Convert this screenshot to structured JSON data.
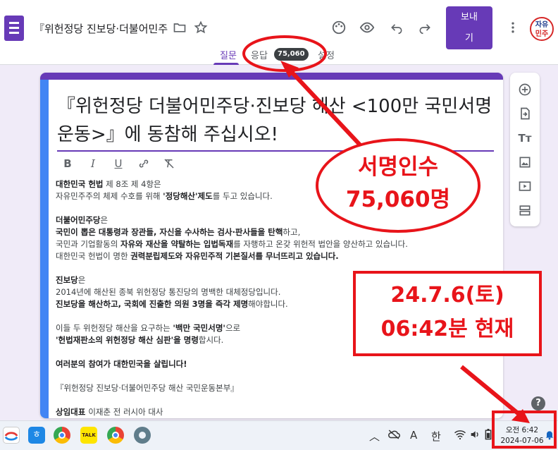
{
  "header": {
    "doc_title": "『위헌정당 진보당·더불어민주",
    "send_label_1": "보내",
    "send_label_2": "기",
    "avatar_text_1": "자유",
    "avatar_text_2": "민주",
    "tabs": [
      {
        "label": "질문"
      },
      {
        "label": "응답"
      },
      {
        "label": "설정"
      }
    ],
    "response_count": "75,060"
  },
  "form": {
    "title": "『위헌정당 더불어민주당·진보당 해산 <100만 국민서명운동>』에 동참해 주십시오!",
    "format_tools": [
      "B",
      "I",
      "U",
      "link",
      "clear"
    ],
    "description": [
      {
        "parts": [
          {
            "t": "대한민국 헌법",
            "b": true
          },
          {
            "t": " 제 8조 제 4항은",
            "b": false
          }
        ]
      },
      {
        "parts": [
          {
            "t": "자유민주주의 체제 수호를 위해 ",
            "b": false
          },
          {
            "t": "'정당해산'제도",
            "b": true
          },
          {
            "t": "를 두고 있습니다.",
            "b": false
          }
        ]
      },
      {
        "gap": true
      },
      {
        "parts": [
          {
            "t": "더불어민주당",
            "b": true
          },
          {
            "t": "은",
            "b": false
          }
        ]
      },
      {
        "parts": [
          {
            "t": "국민이 뽑은 대통령과 장관들, 자신을 수사하는 검사·판사들을 탄핵",
            "b": true
          },
          {
            "t": "하고,",
            "b": false
          }
        ]
      },
      {
        "parts": [
          {
            "t": "국민과 기업활동의 ",
            "b": false
          },
          {
            "t": "자유와 재산을 약탈하는 입법독재",
            "b": true
          },
          {
            "t": "를 자행하고 온갖 위헌적 법안을 양산하고 있습니다.",
            "b": false
          }
        ]
      },
      {
        "parts": [
          {
            "t": "대한민국 헌법이 명한 ",
            "b": false
          },
          {
            "t": "권력분립제도와 자유민주적 기본질서를 무너뜨리고 있습니다.",
            "b": true
          }
        ]
      },
      {
        "gap": true
      },
      {
        "parts": [
          {
            "t": "진보당",
            "b": true
          },
          {
            "t": "은",
            "b": false
          }
        ]
      },
      {
        "parts": [
          {
            "t": "2014년에 해산된 종북 위헌정당 통진당의 명백한 대체정당입니다.",
            "b": false
          }
        ]
      },
      {
        "parts": [
          {
            "t": "진보당을 해산하고, 국회에 진출한 의원 3명을 즉각 제명",
            "b": true
          },
          {
            "t": "해야합니다.",
            "b": false
          }
        ]
      },
      {
        "gap": true
      },
      {
        "parts": [
          {
            "t": "이들 두 위헌정당 해산을 요구하는 ",
            "b": false
          },
          {
            "t": "'백만 국민서명'",
            "b": true
          },
          {
            "t": "으로",
            "b": false
          }
        ]
      },
      {
        "parts": [
          {
            "t": "'헌법재판소의 위헌정당 해산 심판'을 명령",
            "b": true
          },
          {
            "t": "합시다.",
            "b": false
          }
        ]
      },
      {
        "gap": true
      },
      {
        "parts": [
          {
            "t": "여러분의 참여가 대한민국을 살립니다!",
            "b": true
          }
        ]
      },
      {
        "gap": true
      },
      {
        "parts": [
          {
            "t": "『위헌정당 진보당·더불어민주당 해산 국민운동본부』",
            "b": false
          }
        ]
      },
      {
        "gap": true
      },
      {
        "parts": [
          {
            "t": "상임대표 ",
            "b": true
          },
          {
            "t": "이재춘 전 러시아 대사",
            "b": false
          }
        ]
      }
    ]
  },
  "taskbar": {
    "ime_label": "A",
    "lang_label": "한",
    "clock_time": "오전 6:42",
    "clock_date": "2024-07-06"
  },
  "annotations": {
    "signatures_line1": "서명인수",
    "signatures_line2": "75,060명",
    "date_line1": "24.7.6(토)",
    "date_line2": "06:42분  현재"
  },
  "colors": {
    "accent": "#673ab7",
    "annotation": "#e8141a"
  }
}
